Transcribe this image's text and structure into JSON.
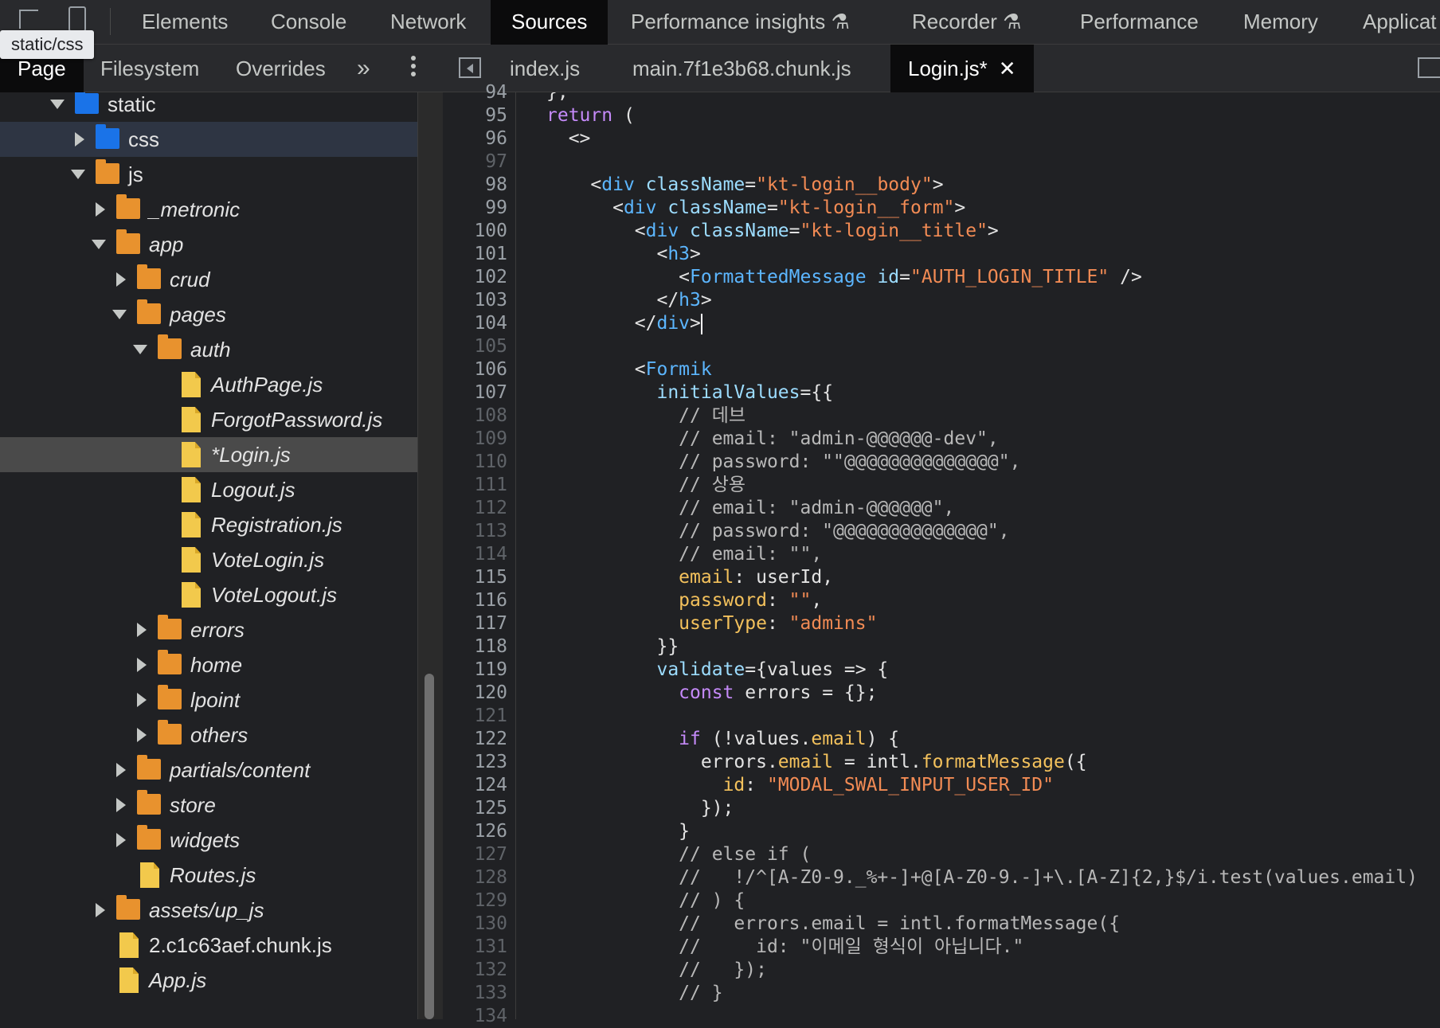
{
  "toolbar": {
    "tabs": [
      "Elements",
      "Console",
      "Network",
      "Sources",
      "Performance insights",
      "Recorder",
      "Performance",
      "Memory",
      "Applicat"
    ],
    "experiment_mark": "⚗",
    "tooltip": "static/css"
  },
  "navigator": {
    "tabs": [
      "Page",
      "Filesystem",
      "Overrides"
    ],
    "more": "»"
  },
  "tree": [
    {
      "label": "static",
      "type": "folder",
      "color": "blue"
    },
    {
      "label": "css",
      "type": "folder",
      "color": "blue"
    },
    {
      "label": "js",
      "type": "folder",
      "color": "orange"
    },
    {
      "label": "_metronic",
      "type": "folder",
      "color": "orange"
    },
    {
      "label": "app",
      "type": "folder",
      "color": "orange"
    },
    {
      "label": "crud",
      "type": "folder",
      "color": "orange"
    },
    {
      "label": "pages",
      "type": "folder",
      "color": "orange"
    },
    {
      "label": "auth",
      "type": "folder",
      "color": "orange"
    },
    {
      "label": "AuthPage.js",
      "type": "file"
    },
    {
      "label": "ForgotPassword.js",
      "type": "file"
    },
    {
      "label": "*Login.js",
      "type": "file"
    },
    {
      "label": "Logout.js",
      "type": "file"
    },
    {
      "label": "Registration.js",
      "type": "file"
    },
    {
      "label": "VoteLogin.js",
      "type": "file"
    },
    {
      "label": "VoteLogout.js",
      "type": "file"
    },
    {
      "label": "errors",
      "type": "folder",
      "color": "orange"
    },
    {
      "label": "home",
      "type": "folder",
      "color": "orange"
    },
    {
      "label": "lpoint",
      "type": "folder",
      "color": "orange"
    },
    {
      "label": "others",
      "type": "folder",
      "color": "orange"
    },
    {
      "label": "partials/content",
      "type": "folder",
      "color": "orange"
    },
    {
      "label": "store",
      "type": "folder",
      "color": "orange"
    },
    {
      "label": "widgets",
      "type": "folder",
      "color": "orange"
    },
    {
      "label": "Routes.js",
      "type": "file"
    },
    {
      "label": "assets/up_js",
      "type": "folder",
      "color": "orange"
    },
    {
      "label": "2.c1c63aef.chunk.js",
      "type": "file"
    },
    {
      "label": "App.js",
      "type": "file"
    }
  ],
  "editor": {
    "tabs": [
      "index.js",
      "main.7f1e3b68.chunk.js",
      "Login.js*"
    ],
    "close": "✕",
    "first_line": 94,
    "lines": [
      "};",
      "return (",
      "  <>",
      "",
      "    <div className=\"kt-login__body\">",
      "      <div className=\"kt-login__form\">",
      "        <div className=\"kt-login__title\">",
      "          <h3>",
      "            <FormattedMessage id=\"AUTH_LOGIN_TITLE\" />",
      "          </h3>",
      "        </div>",
      "",
      "        <Formik",
      "          initialValues={{",
      "            // 데브",
      "            // email: \"admin-@@@@@@-dev\",",
      "            // password: \"\"@@@@@@@@@@@@@@\",",
      "            // 상용",
      "            // email: \"admin-@@@@@@\",",
      "            // password: \"@@@@@@@@@@@@@@\",",
      "            // email: \"\",",
      "            email: userId,",
      "            password: \"\",",
      "            userType: \"admins\"",
      "          }}",
      "          validate={values => {",
      "            const errors = {};",
      "",
      "            if (!values.email) {",
      "              errors.email = intl.formatMessage({",
      "                id: \"MODAL_SWAL_INPUT_USER_ID\"",
      "              });",
      "            }",
      "            // else if (",
      "            //   !/^[A-Z0-9._%+-]+@[A-Z0-9.-]+\\.[A-Z]{2,}$/i.test(values.email)",
      "            // ) {",
      "            //   errors.email = intl.formatMessage({",
      "            //     id: \"이메일 형식이 아닙니다.\"",
      "            //   });",
      "            // }",
      ""
    ]
  }
}
